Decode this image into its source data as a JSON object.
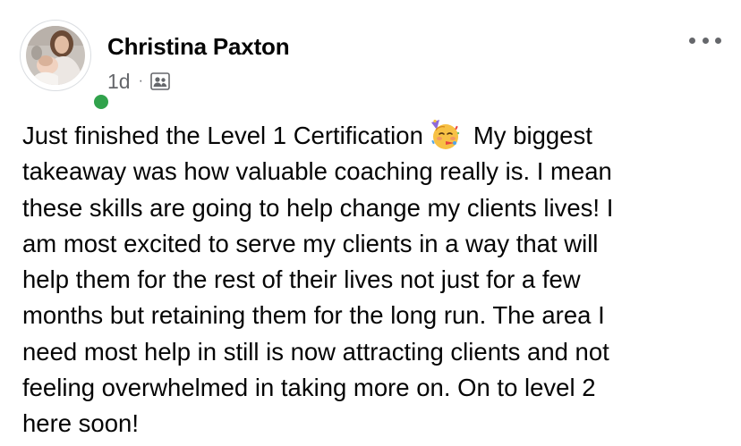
{
  "post": {
    "author": {
      "name": "Christina Paxton",
      "online": true,
      "avatar_icon": "profile-photo"
    },
    "meta": {
      "time": "1d",
      "separator": "·",
      "audience_icon": "group-members-icon"
    },
    "menu_icon": "more-options-icon",
    "body": {
      "lines": [
        "Just finished the Level 1 Certification",
        "My biggest",
        "takeaway was how valuable coaching really is. I mean",
        "these skills are going to help change my clients lives! I",
        "am most excited to serve my clients in a way that will",
        "help them for the rest of their lives not just for a few",
        "months but retaining them for the long run. The area I",
        "need most help in still is now attracting clients and not",
        "feeling overwhelmed in taking more on. On to level 2",
        "here soon!"
      ],
      "emoji": "partying-face-emoji"
    }
  },
  "colors": {
    "text": "#050505",
    "secondary_text": "#65676b",
    "online": "#31a24c",
    "background": "#ffffff"
  }
}
